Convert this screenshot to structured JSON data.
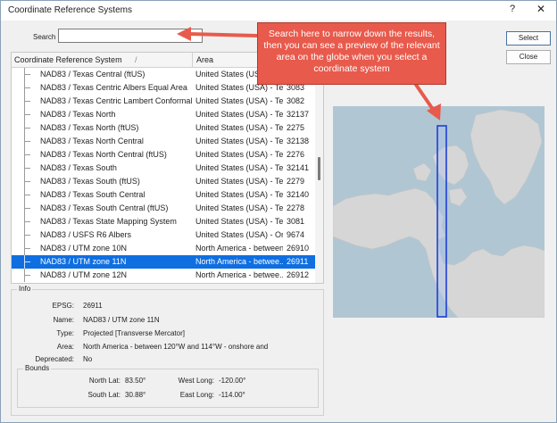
{
  "window": {
    "title": "Coordinate Reference Systems",
    "help_glyph": "?",
    "close_glyph": "✕"
  },
  "search": {
    "label": "Search",
    "value": "",
    "placeholder": ""
  },
  "buttons": {
    "select": "Select",
    "close": "Close"
  },
  "table": {
    "headers": {
      "name": "Coordinate Reference System",
      "sort_glyph": "/",
      "area": "Area"
    },
    "rows": [
      {
        "name": "NAD83 / Texas Central (ftUS)",
        "area": "United States (US)",
        "code": ""
      },
      {
        "name": "NAD83 / Texas Centric Albers Equal Area",
        "area": "United States (USA) - Te...",
        "code": "3083"
      },
      {
        "name": "NAD83 / Texas Centric Lambert Conformal",
        "area": "United States (USA) - Te...",
        "code": "3082"
      },
      {
        "name": "NAD83 / Texas North",
        "area": "United States (USA) - Te...",
        "code": "32137"
      },
      {
        "name": "NAD83 / Texas North (ftUS)",
        "area": "United States (USA) - Te...",
        "code": "2275"
      },
      {
        "name": "NAD83 / Texas North Central",
        "area": "United States (USA) - Te...",
        "code": "32138"
      },
      {
        "name": "NAD83 / Texas North Central (ftUS)",
        "area": "United States (USA) - Te...",
        "code": "2276"
      },
      {
        "name": "NAD83 / Texas South",
        "area": "United States (USA) - Te...",
        "code": "32141"
      },
      {
        "name": "NAD83 / Texas South (ftUS)",
        "area": "United States (USA) - Te...",
        "code": "2279"
      },
      {
        "name": "NAD83 / Texas South Central",
        "area": "United States (USA) - Te...",
        "code": "32140"
      },
      {
        "name": "NAD83 / Texas South Central (ftUS)",
        "area": "United States (USA) - Te...",
        "code": "2278"
      },
      {
        "name": "NAD83 / Texas State Mapping System",
        "area": "United States (USA) - Te...",
        "code": "3081"
      },
      {
        "name": "NAD83 / USFS R6 Albers",
        "area": "United States (USA) - Or...",
        "code": "9674"
      },
      {
        "name": "NAD83 / UTM zone 10N",
        "area": "North America - between...",
        "code": "26910"
      },
      {
        "name": "NAD83 / UTM zone 11N",
        "area": "North America - betwee...",
        "code": "26911"
      },
      {
        "name": "NAD83 / UTM zone 12N",
        "area": "North America - betwee...",
        "code": "26912"
      }
    ],
    "selected_index": 14
  },
  "info": {
    "legend": "Info",
    "epsg_label": "EPSG:",
    "epsg": "26911",
    "name_label": "Name:",
    "name": "NAD83 / UTM zone 11N",
    "type_label": "Type:",
    "type": "Projected [Transverse Mercator]",
    "area_label": "Area:",
    "area": "North America - between 120°W and 114°W - onshore and",
    "deprecated_label": "Deprecated:",
    "deprecated": "No"
  },
  "bounds": {
    "legend": "Bounds",
    "north_label": "North Lat:",
    "north": "83.50°",
    "south_label": "South Lat:",
    "south": "30.88°",
    "west_label": "West Long:",
    "west": "-120.00°",
    "east_label": "East Long:",
    "east": "-114.00°"
  },
  "callout": {
    "text": "Search here to narrow down the results, then you can see a preview of the relevant area on the globe when you select a coordinate system"
  },
  "colors": {
    "selection": "#0f6fe1",
    "callout": "#e85a4c",
    "land": "#d6d6d6",
    "water": "#b1c6d3",
    "zone": "#1f3fd6"
  }
}
